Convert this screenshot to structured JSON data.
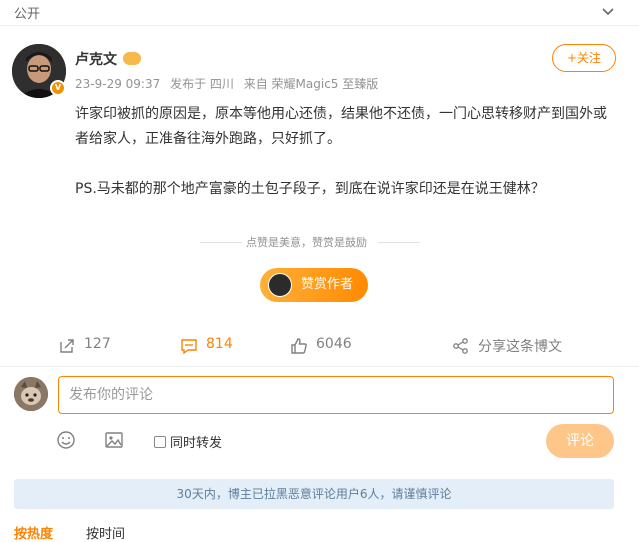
{
  "top_bar": {
    "visibility": "公开"
  },
  "author": {
    "name": "卢克文",
    "date": "23-9-29 09:37",
    "location": "发布于 四川",
    "device": "来自 荣耀Magic5 至臻版",
    "follow_label": "+关注"
  },
  "post": {
    "paragraphs": [
      "许家印被抓的原因是，原本等他用心还债，结果他不还债，一门心思转移财产到国外或者给家人，正准备往海外跑路，只好抓了。",
      "PS.马未都的那个地产富豪的土包子段子，到底在说许家印还是在说王健林？"
    ]
  },
  "reward": {
    "tagline": "点赞是美意，赞赏是鼓励",
    "button_label": "赞赏作者"
  },
  "actions": {
    "forward_count": "127",
    "comment_count": "814",
    "like_count": "6046",
    "share_label": "分享这条博文"
  },
  "comment_box": {
    "placeholder": "发布你的评论",
    "repost_label": "同时转发",
    "submit_label": "评论"
  },
  "notice": "30天内，博主已拉黑恶意评论用户6人，请谨慎评论",
  "sort_tabs": [
    "按热度",
    "按时间"
  ],
  "colors": {
    "accent": "#ff8200",
    "notice_bg": "#e3eef8",
    "submit_disabled": "#ffc68a"
  }
}
